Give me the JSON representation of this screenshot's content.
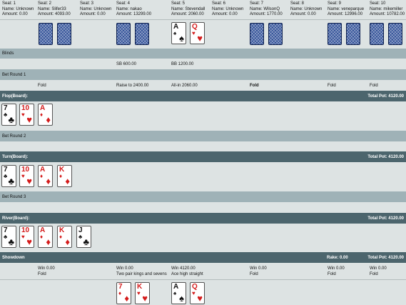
{
  "seats": [
    {
      "seat": "Seat: 1",
      "name": "Name: Unknown",
      "amount": "Amount: 0.00"
    },
    {
      "seat": "Seat: 2",
      "name": "Name: Slifer33",
      "amount": "Amount: 4093.00"
    },
    {
      "seat": "Seat: 3",
      "name": "Name: Unknown",
      "amount": "Amount: 0.00"
    },
    {
      "seat": "Seat: 4",
      "name": "Name: nakao",
      "amount": "Amount: 13299.00"
    },
    {
      "seat": "Seat: 5",
      "name": "Name: Stevendall",
      "amount": "Amount: 2060.00"
    },
    {
      "seat": "Seat: 6",
      "name": "Name: Unknown",
      "amount": "Amount: 0.00"
    },
    {
      "seat": "Seat: 7",
      "name": "Name: WilsonQ",
      "amount": "Amount: 1770.00"
    },
    {
      "seat": "Seat: 8",
      "name": "Name: Unknown",
      "amount": "Amount: 0.00"
    },
    {
      "seat": "Seat: 9",
      "name": "Name: veneparque",
      "amount": "Amount: 12996.00"
    },
    {
      "seat": "Seat: 10",
      "name": "Name: mikemiller",
      "amount": "Amount: 10782.00"
    }
  ],
  "hole_cards_seat5": [
    {
      "rank": "A",
      "suit": "♠",
      "color": "blk"
    },
    {
      "rank": "Q",
      "suit": "♥",
      "color": "red"
    }
  ],
  "sections": {
    "blinds": "Blinds",
    "bet_round_1": "Bet Round 1",
    "flop": "Flop(Board):",
    "bet_round_2": "Bet Round 2",
    "turn": "Turn(Board):",
    "bet_round_3": "Bet Round 3",
    "river": "River(Board):",
    "showdown": "Showdown"
  },
  "pots": {
    "flop": "Total Pot: 4120.00",
    "turn": "Total Pot: 4120.00",
    "river": "Total Pot: 4120.00",
    "showdown": "Total Pot: 4120.00"
  },
  "rake": "Rake: 0.00",
  "blinds": {
    "sb": "SB 600.00",
    "bb": "BB 1200.00"
  },
  "bet_round_1": {
    "seat2": "Fold",
    "seat4": "Raise to 2400.00",
    "seat5": "All-in 2060.00",
    "seat7": "Fold",
    "seat9": "Fold",
    "seat10": "Fold"
  },
  "board": {
    "flop": [
      {
        "rank": "7",
        "suit": "♣",
        "color": "blk"
      },
      {
        "rank": "10",
        "suit": "♥",
        "color": "red"
      },
      {
        "rank": "A",
        "suit": "♦",
        "color": "red"
      }
    ],
    "turn_extra": {
      "rank": "K",
      "suit": "♦",
      "color": "red"
    },
    "river_extra": {
      "rank": "J",
      "suit": "♣",
      "color": "blk"
    }
  },
  "showdown": {
    "seat2": {
      "win": "Win 0.00",
      "result": "Fold"
    },
    "seat4": {
      "win": "Win 0.00",
      "result": "Two pair kings and sevens"
    },
    "seat5": {
      "win": "Win 4120.00",
      "result": "Ace high straight"
    },
    "seat7": {
      "win": "Win 0.00",
      "result": "Fold"
    },
    "seat9": {
      "win": "Win 0.00",
      "result": "Fold"
    },
    "seat10": {
      "win": "Win 0.00",
      "result": "Fold"
    }
  },
  "showdown_cards": {
    "seat4": [
      {
        "rank": "7",
        "suit": "♦",
        "color": "red"
      },
      {
        "rank": "K",
        "suit": "♥",
        "color": "red"
      }
    ],
    "seat5": [
      {
        "rank": "A",
        "suit": "♠",
        "color": "blk"
      },
      {
        "rank": "Q",
        "suit": "♥",
        "color": "red"
      }
    ]
  }
}
